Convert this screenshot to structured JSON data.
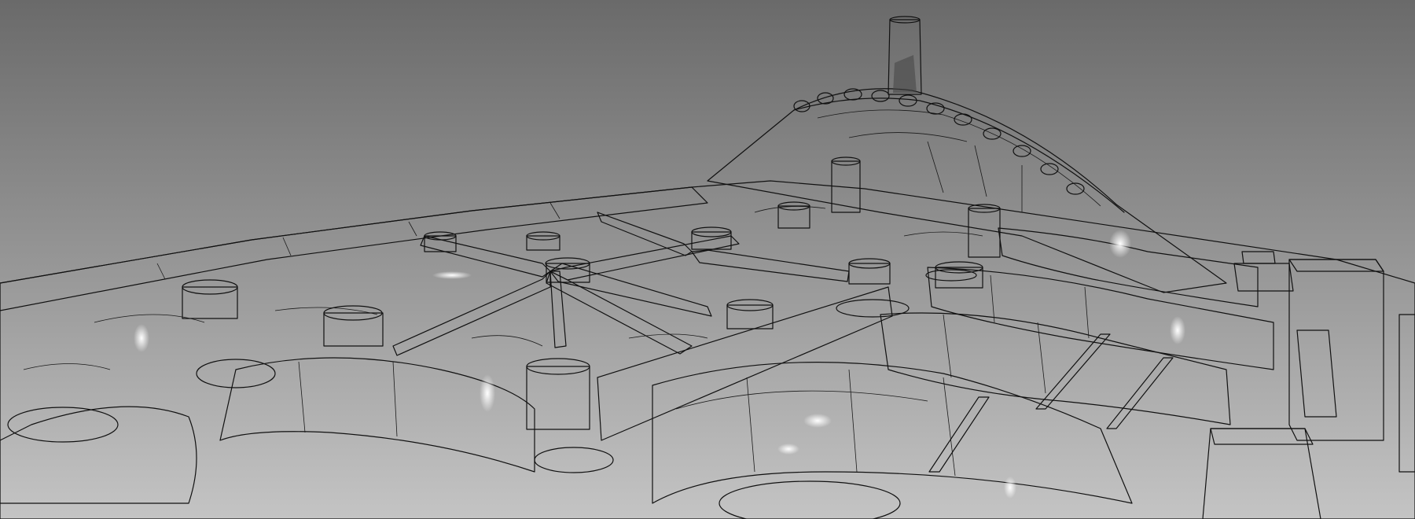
{
  "scene": {
    "kind": "cad-3d-viewport",
    "subject": "die-cast-part",
    "render_style": "shaded-with-edges",
    "background_top_color": "#6a6a6a",
    "background_bottom_color": "#c4c4c4",
    "surface_light_color": "#f2f2f2",
    "surface_mid_color": "#8c8c8c",
    "surface_dark_color": "#3c3c3c",
    "edge_color": "#111111"
  }
}
